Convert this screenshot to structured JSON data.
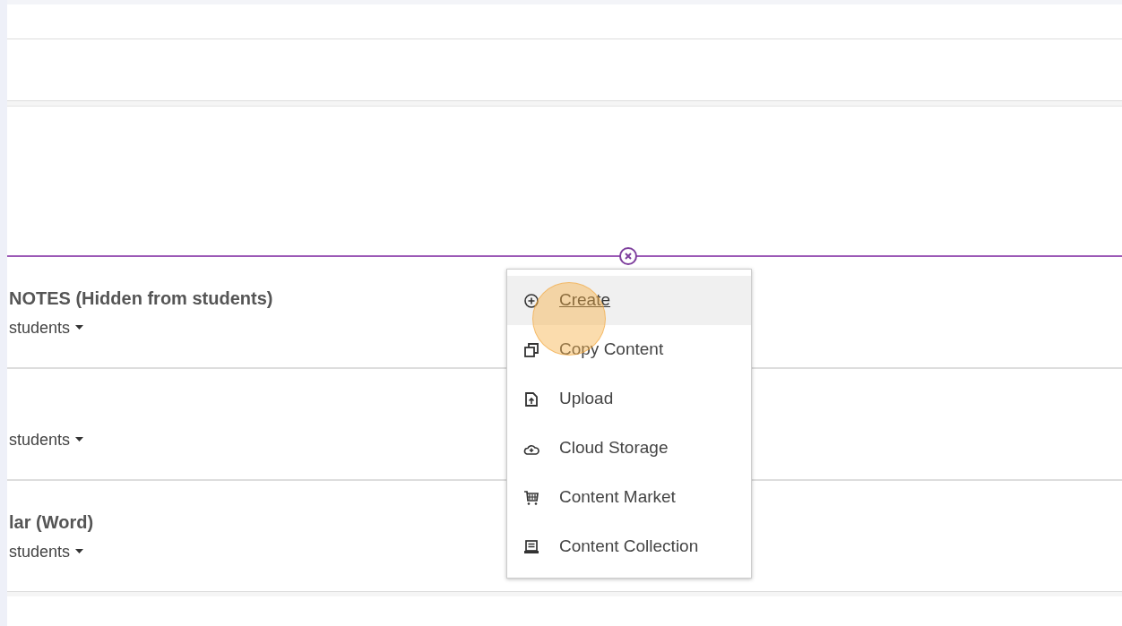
{
  "content_items": [
    {
      "title": "NOTES (Hidden from students)",
      "visibility": "students"
    },
    {
      "visibility": "students"
    },
    {
      "title": "lar (Word)",
      "visibility": "students"
    }
  ],
  "add_menu": {
    "items": [
      {
        "kind": "create",
        "label": "Create",
        "selected": true
      },
      {
        "kind": "copy",
        "label": "Copy Content",
        "selected": false
      },
      {
        "kind": "upload",
        "label": "Upload",
        "selected": false
      },
      {
        "kind": "cloud",
        "label": "Cloud Storage",
        "selected": false
      },
      {
        "kind": "market",
        "label": "Content Market",
        "selected": false
      },
      {
        "kind": "collection",
        "label": "Content Collection",
        "selected": false
      }
    ]
  }
}
